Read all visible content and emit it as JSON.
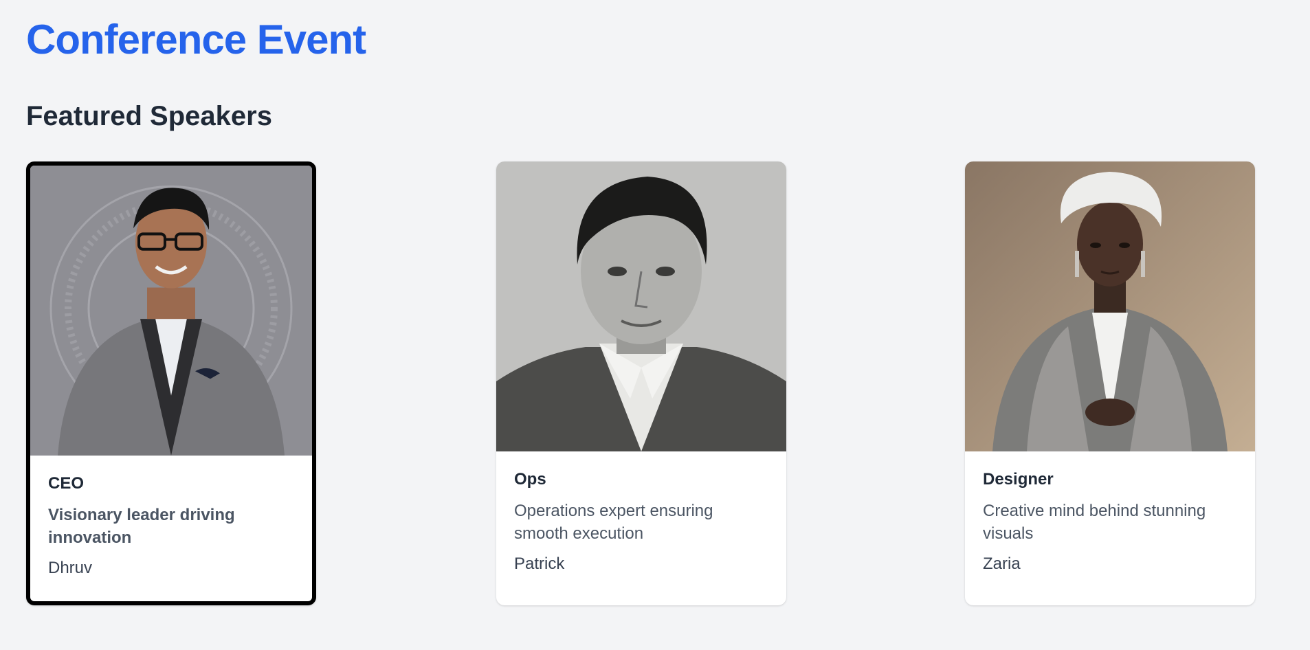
{
  "page": {
    "title": "Conference Event",
    "section_title": "Featured Speakers"
  },
  "colors": {
    "background": "#f3f4f6",
    "title": "#2563eb",
    "heading": "#1f2937",
    "card": "#ffffff",
    "selected_border": "#000000",
    "body_text": "#4b5563",
    "name_text": "#374151"
  },
  "speakers": [
    {
      "role": "CEO",
      "description": "Visionary leader driving innovation",
      "name": "Dhruv",
      "selected": true,
      "photo": "portrait-man-glasses-suit"
    },
    {
      "role": "Ops",
      "description": "Operations expert ensuring smooth execution",
      "name": "Patrick",
      "selected": false,
      "photo": "portrait-man-black-white"
    },
    {
      "role": "Designer",
      "description": "Creative mind behind stunning visuals",
      "name": "Zaria",
      "selected": false,
      "photo": "portrait-woman-headwrap"
    }
  ]
}
